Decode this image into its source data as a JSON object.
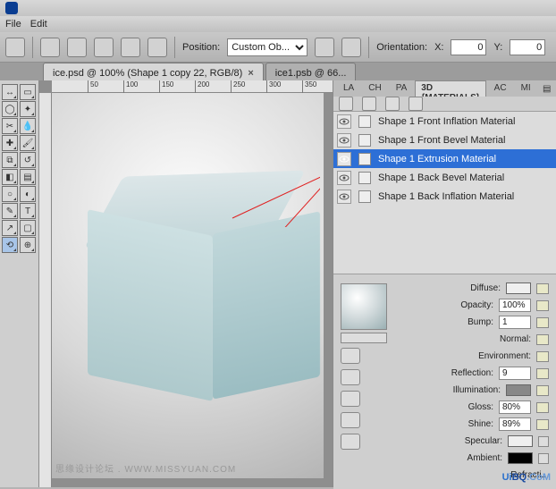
{
  "menubar": [
    "File",
    "Edit"
  ],
  "optbar": {
    "position_label": "Position:",
    "position_value": "Custom Ob...",
    "orientation_label": "Orientation:",
    "x_label": "X:",
    "x_value": "0",
    "y_label": "Y:",
    "y_value": "0"
  },
  "tabs": [
    {
      "label": "ice.psd @ 100% (Shape 1 copy 22, RGB/8)",
      "active": true
    },
    {
      "label": "ice1.psb @ 66...",
      "active": false
    }
  ],
  "ruler_ticks": [
    "50",
    "100",
    "150",
    "200",
    "250",
    "300",
    "350"
  ],
  "panel_tabs": [
    "LA",
    "CH",
    "PA",
    "3D {MATERIALS}",
    "AC",
    "MI"
  ],
  "panel_active_tab": 3,
  "materials": [
    {
      "name": "Shape 1 Front Inflation Material",
      "selected": false
    },
    {
      "name": "Shape 1 Front Bevel Material",
      "selected": false
    },
    {
      "name": "Shape 1 Extrusion Material",
      "selected": true
    },
    {
      "name": "Shape 1 Back Bevel Material",
      "selected": false
    },
    {
      "name": "Shape 1 Back Inflation Material",
      "selected": false
    }
  ],
  "props": {
    "diffuse_label": "Diffuse:",
    "opacity_label": "Opacity:",
    "opacity_value": "100%",
    "bump_label": "Bump:",
    "bump_value": "1",
    "normal_label": "Normal:",
    "environment_label": "Environment:",
    "reflection_label": "Reflection:",
    "reflection_value": "9",
    "illumination_label": "Illumination:",
    "gloss_label": "Gloss:",
    "gloss_value": "80%",
    "shine_label": "Shine:",
    "shine_value": "89%",
    "specular_label": "Specular:",
    "ambient_label": "Ambient:",
    "refraction_label": "Refracti..."
  },
  "watermark": "思缘设计论坛 . WWW.MISSYUAN.COM",
  "brand": {
    "u": "Ui",
    "bq": "BQ",
    "com": ".CoM"
  }
}
